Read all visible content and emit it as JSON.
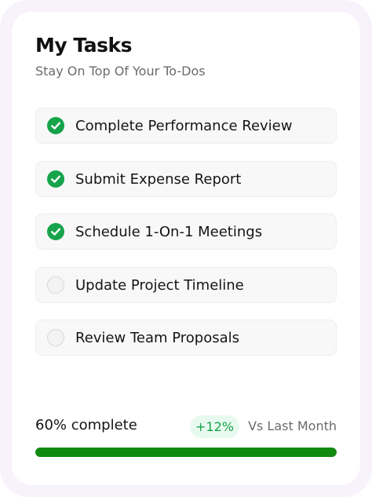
{
  "header": {
    "title": "My Tasks",
    "subtitle": "Stay On Top Of Your To-Dos"
  },
  "tasks": [
    {
      "label": "Complete Performance Review",
      "done": true
    },
    {
      "label": "Submit Expense Report",
      "done": true
    },
    {
      "label": "Schedule 1-On-1 Meetings",
      "done": true
    },
    {
      "label": "Update Project Timeline",
      "done": false
    },
    {
      "label": "Review Team Proposals",
      "done": false
    }
  ],
  "progress": {
    "complete_text": "60% complete",
    "percent": 100,
    "change_badge": "+12%",
    "comparison_text": "Vs Last Month"
  },
  "colors": {
    "accent_green": "#16a34a",
    "bar_green": "#118a11",
    "badge_bg": "#e8faef",
    "outer_bg": "#f8f2fd"
  },
  "icons": {
    "done": "check-circle-icon",
    "todo": "empty-circle-icon"
  }
}
